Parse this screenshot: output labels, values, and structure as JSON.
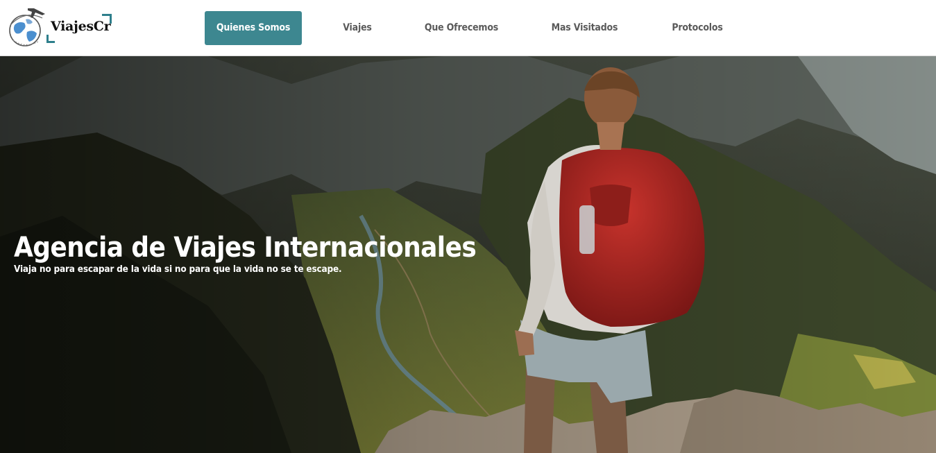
{
  "brand": {
    "name": "ViajesCr",
    "accent_color": "#3d8790",
    "emblem_icon": "globe-airplane-icon"
  },
  "nav": {
    "items": [
      {
        "label": "Quienes Somos",
        "active": true
      },
      {
        "label": "Viajes",
        "active": false
      },
      {
        "label": "Que Ofrecemos",
        "active": false
      },
      {
        "label": "Mas Visitados",
        "active": false
      },
      {
        "label": "Protocolos",
        "active": false
      }
    ]
  },
  "hero": {
    "title": "Agencia de Viajes Internacionales",
    "subtitle": "Viaja no para escapar de la vida si no para que la vida no se te escape.",
    "background": "hiker-with-red-backpack-over-mountain-valley"
  }
}
